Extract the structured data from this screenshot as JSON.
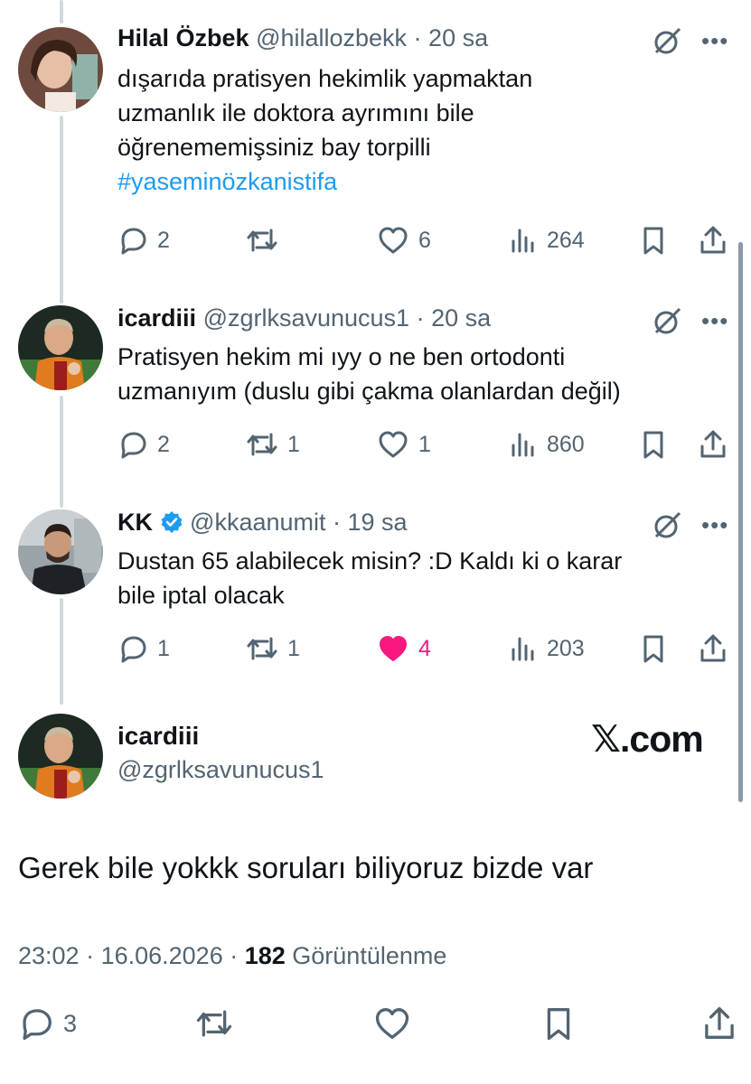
{
  "colors": {
    "text": "#0f1419",
    "secondary": "#536471",
    "link": "#1d9bf0",
    "like": "#f91880",
    "border": "#cfd9de"
  },
  "replies": [
    {
      "name": "Hilal Özbek",
      "handle": "@hilallozbekk",
      "sep": " · ",
      "time": "20 sa",
      "verified": false,
      "lines": [
        "dışarıda pratisyen hekimlik yapmaktan",
        "uzmanlık ile doktora ayrımını bile",
        "öğrenememişsiniz bay torpilli"
      ],
      "hashtag": "#yaseminözkanistifa",
      "stats": {
        "replies": "2",
        "reposts": "",
        "likes": "6",
        "views": "264"
      },
      "liked": false
    },
    {
      "name": "icardiii",
      "handle": "@zgrlksavunucus1",
      "sep": " · ",
      "time": "20 sa",
      "verified": false,
      "lines": [
        "Pratisyen hekim mi ıyy o ne ben ortodonti",
        "uzmanıyım (duslu gibi çakma olanlardan değil)"
      ],
      "hashtag": "",
      "stats": {
        "replies": "2",
        "reposts": "1",
        "likes": "1",
        "views": "860"
      },
      "liked": false
    },
    {
      "name": "KK",
      "handle": "@kkaanumit",
      "sep": " · ",
      "time": "19 sa",
      "verified": true,
      "lines": [
        "Dustan 65 alabilecek misin? :D Kaldı ki o karar",
        "bile iptal olacak"
      ],
      "hashtag": "",
      "stats": {
        "replies": "1",
        "reposts": "1",
        "likes": "4",
        "views": "203"
      },
      "liked": true
    }
  ],
  "main": {
    "name": "icardiii",
    "handle": "@zgrlksavunucus1",
    "watermark": "𝕏.com",
    "text": "Gerek bile yokkk soruları biliyoruz bizde var",
    "time": "23:02",
    "date": "16.06.2026",
    "sep1": " · ",
    "sep2": " · ",
    "views": "182",
    "views_label": " Görüntülenme",
    "replies": "3"
  }
}
